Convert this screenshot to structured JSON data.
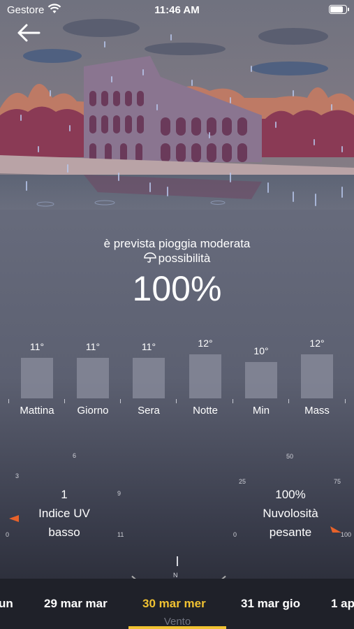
{
  "status_bar": {
    "carrier": "Gestore",
    "time": "11:46 AM"
  },
  "summary": {
    "description": "è prevista pioggia moderata",
    "chance_label": "possibilità",
    "chance_value": "100%"
  },
  "temperatures": [
    {
      "label": "Mattina",
      "value": "11°",
      "level": 11
    },
    {
      "label": "Giorno",
      "value": "11°",
      "level": 11
    },
    {
      "label": "Sera",
      "value": "11°",
      "level": 11
    },
    {
      "label": "Notte",
      "value": "12°",
      "level": 12
    },
    {
      "label": "Min",
      "value": "10°",
      "level": 10
    },
    {
      "label": "Mass",
      "value": "12°",
      "level": 12
    }
  ],
  "uv": {
    "value": "1",
    "label": "Indice UV",
    "level": "basso",
    "scale": [
      "0",
      "3",
      "6",
      "9",
      "11"
    ]
  },
  "cloud": {
    "value": "100%",
    "label": "Nuvolosità",
    "level": "pesante",
    "scale": [
      "0",
      "25",
      "50",
      "75",
      "100"
    ]
  },
  "compass": {
    "north": "N"
  },
  "date_tabs": [
    {
      "label": "un",
      "active": false
    },
    {
      "label": "29 mar mar",
      "active": false
    },
    {
      "label": "30 mar mer",
      "active": true
    },
    {
      "label": "31 mar gio",
      "active": false
    },
    {
      "label": "1 ap",
      "active": false
    }
  ],
  "bottom_label": "Vento",
  "colors": {
    "accent": "#f1c232",
    "indicator": "#e8622a",
    "building": "#8a7590",
    "foliage": "#8a3a55"
  }
}
